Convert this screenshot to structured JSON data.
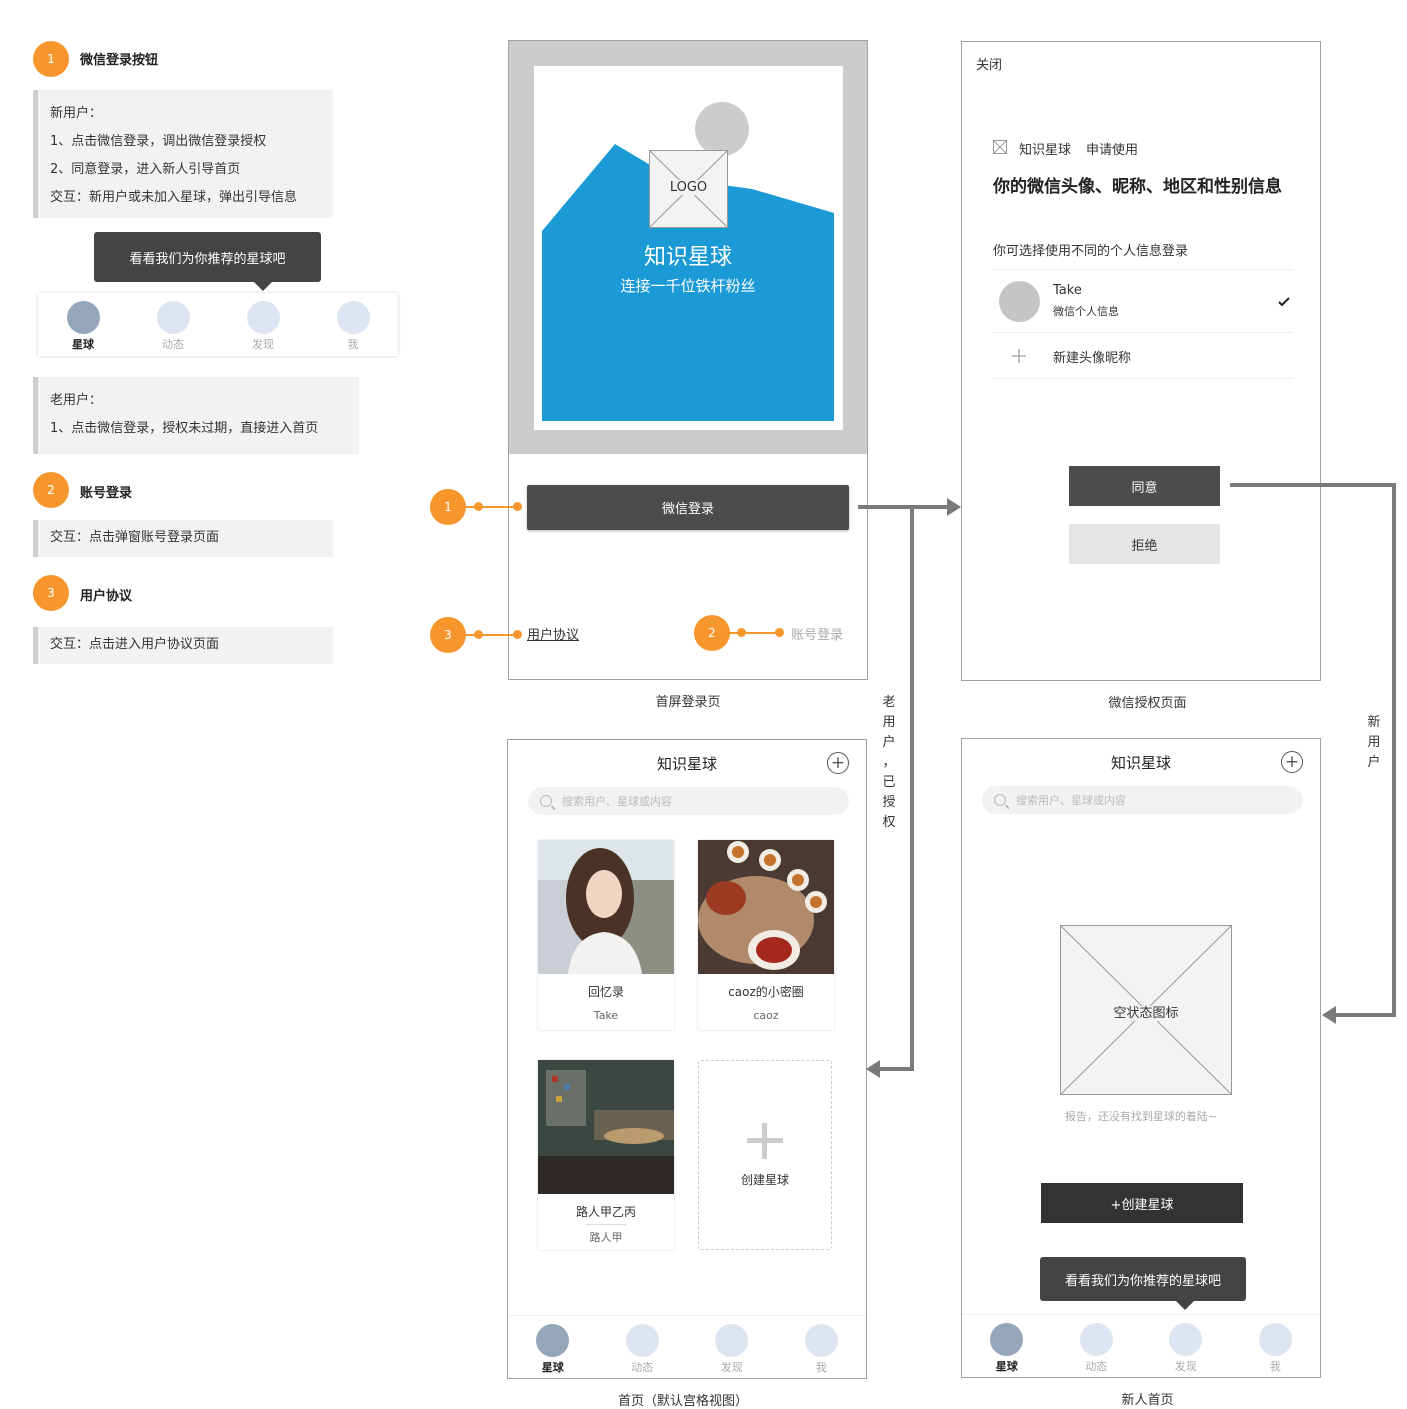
{
  "colors": {
    "accent": "#f7962d",
    "brand_blue": "#1b9ad6",
    "dark_button": "#4c4c4c",
    "tab_active": "#95a6bb",
    "tab_inactive": "#dce5f1"
  },
  "annotations": {
    "a1": {
      "number": "1",
      "title": "微信登录按钮"
    },
    "new_user_note": [
      "新用户：",
      "1、点击微信登录，调出微信登录授权",
      "2、同意登录，进入新人引导首页",
      "交互：新用户或未加入星球，弹出引导信息"
    ],
    "tooltip": "看看我们为你推荐的星球吧",
    "tabs": [
      "星球",
      "动态",
      "发现",
      "我"
    ],
    "old_user_note": [
      "老用户：",
      "1、点击微信登录，授权未过期，直接进入首页"
    ],
    "a2": {
      "number": "2",
      "title": "账号登录",
      "note": "交互：点击弹窗账号登录页面"
    },
    "a3": {
      "number": "3",
      "title": "用户协议",
      "note": "交互：点击进入用户协议页面"
    }
  },
  "login_screen": {
    "logo": "LOGO",
    "app_name": "知识星球",
    "slogan": "连接一千位铁杆粉丝",
    "wechat_login": "微信登录",
    "user_agreement": "用户协议",
    "account_login": "账号登录",
    "marker_1": "1",
    "marker_2": "2",
    "marker_3": "3",
    "caption": "首屏登录页"
  },
  "auth_screen": {
    "close": "关闭",
    "app_name": "知识星球",
    "apply": "申请使用",
    "heading": "你的微信头像、昵称、地区和性别信息",
    "choose_hint": "你可选择使用不同的个人信息登录",
    "profile_name": "Take",
    "profile_sub": "微信个人信息",
    "new_profile": "新建头像昵称",
    "agree": "同意",
    "reject": "拒绝",
    "caption": "微信授权页面"
  },
  "flow_labels": {
    "old_user": [
      "老",
      "用",
      "户",
      "，",
      "已",
      "授",
      "权"
    ],
    "new_user": [
      "新",
      "用",
      "户"
    ]
  },
  "home_screen": {
    "title": "知识星球",
    "search_placeholder": "搜索用户、星球或内容",
    "cards": [
      {
        "title": "回忆录",
        "owner": "Take"
      },
      {
        "title": "caoz的小密圈",
        "owner": "caoz"
      },
      {
        "title": "路人甲乙丙",
        "owner": "路人甲"
      }
    ],
    "create": "创建星球",
    "tabs": [
      "星球",
      "动态",
      "发现",
      "我"
    ],
    "caption": "首页（默认宫格视图）"
  },
  "new_home_screen": {
    "title": "知识星球",
    "search_placeholder": "搜索用户、星球或内容",
    "empty_icon_label": "空状态图标",
    "empty_text": "报告，还没有找到星球的着陆~",
    "create_button": "+创建星球",
    "tooltip": "看看我们为你推荐的星球吧",
    "tabs": [
      "星球",
      "动态",
      "发现",
      "我"
    ],
    "caption": "新人首页"
  }
}
